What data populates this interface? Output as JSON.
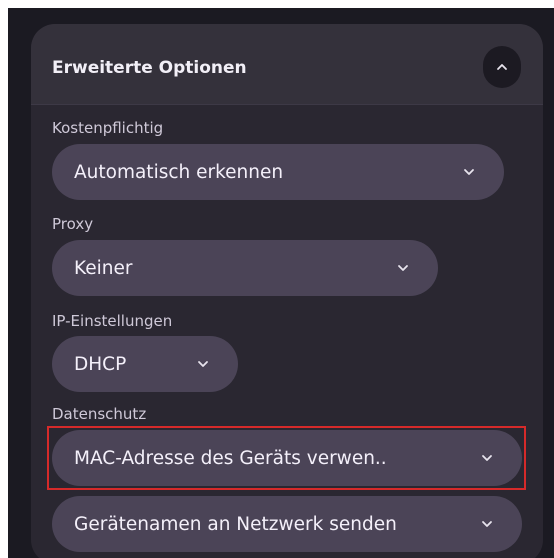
{
  "section": {
    "title": "Erweiterte Optionen",
    "collapse_icon": "chevron-up-icon"
  },
  "fields": {
    "metered": {
      "label": "Kostenpflichtig",
      "value": "Automatisch erkennen"
    },
    "proxy": {
      "label": "Proxy",
      "value": "Keiner"
    },
    "ip": {
      "label": "IP-Einstellungen",
      "value": "DHCP"
    },
    "privacy": {
      "label": "Datenschutz",
      "value": "MAC-Adresse des Geräts verwen.."
    },
    "hostname": {
      "value": "Gerätenamen an Netzwerk senden"
    }
  },
  "colors": {
    "background": "#1b1a22",
    "panel": "#2a2731",
    "header": "#34313b",
    "select": "#4b4457",
    "highlight": "#d62a2a",
    "text": "#f4f0fa"
  }
}
